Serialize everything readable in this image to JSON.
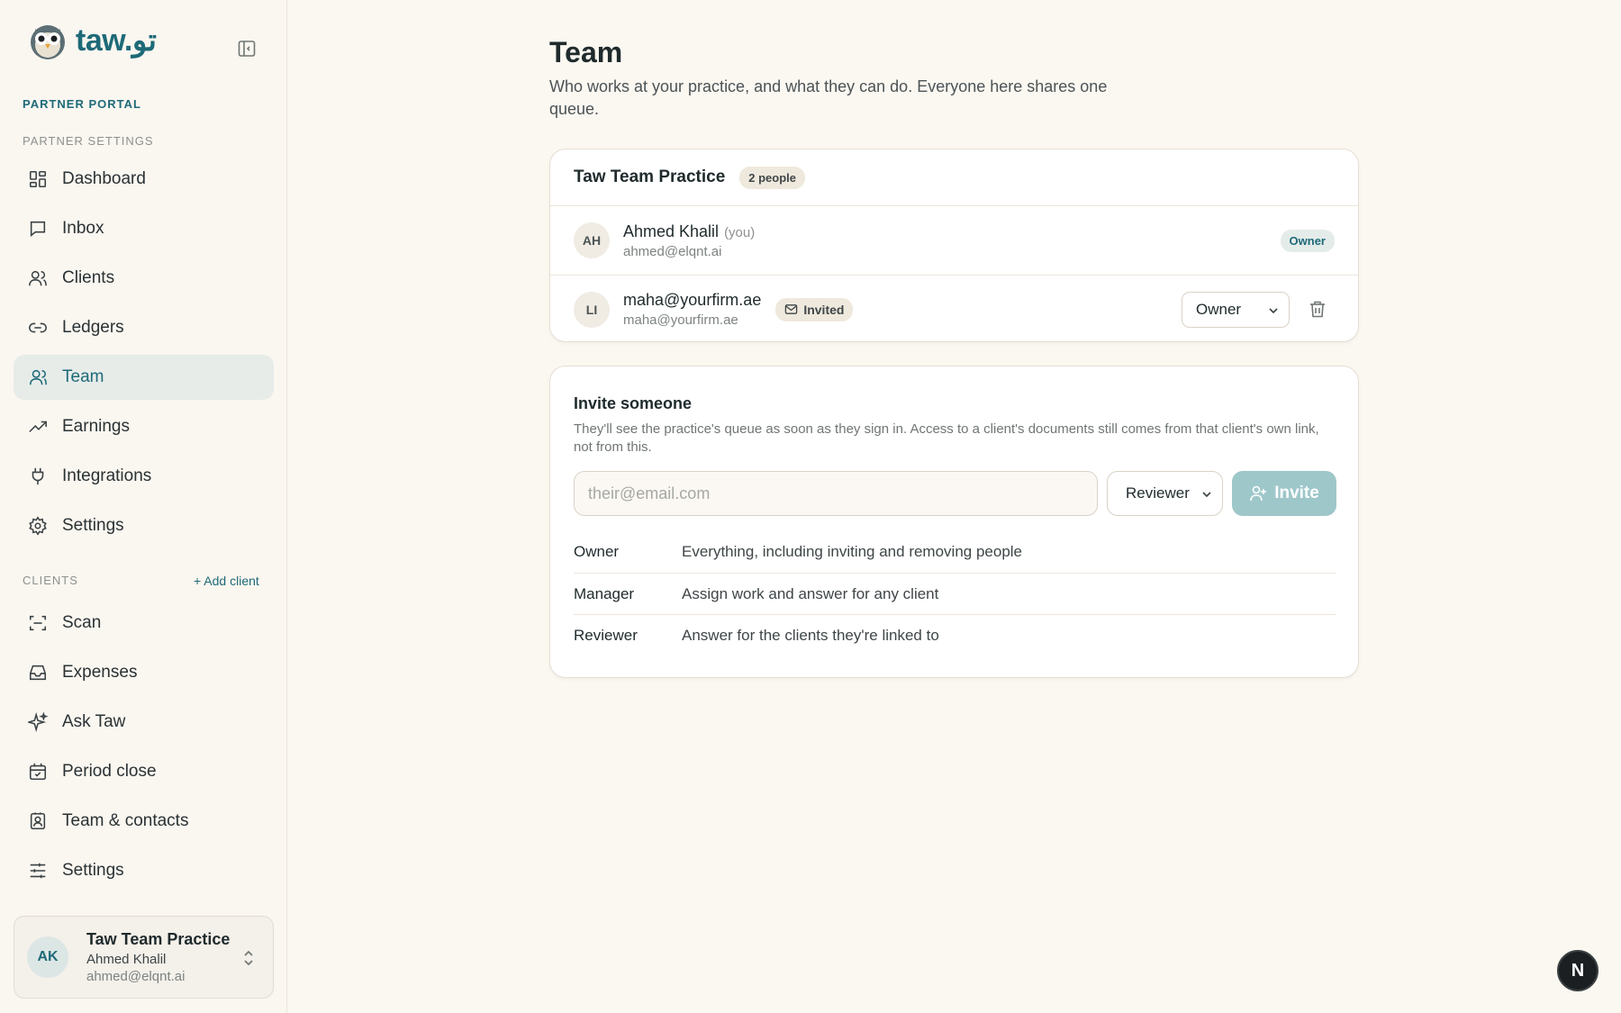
{
  "brand": {
    "wordmark": "taw.تو"
  },
  "sidebar": {
    "portal_label": "PARTNER PORTAL",
    "settings_label": "PARTNER SETTINGS",
    "partner_items": [
      {
        "label": "Dashboard",
        "icon": "dashboard-icon"
      },
      {
        "label": "Inbox",
        "icon": "message-icon"
      },
      {
        "label": "Clients",
        "icon": "users-icon"
      },
      {
        "label": "Ledgers",
        "icon": "link-icon"
      },
      {
        "label": "Team",
        "icon": "user-icon",
        "active": true
      },
      {
        "label": "Earnings",
        "icon": "trending-up-icon"
      },
      {
        "label": "Integrations",
        "icon": "plug-icon"
      },
      {
        "label": "Settings",
        "icon": "gear-icon"
      }
    ],
    "clients_label": "CLIENTS",
    "add_client": "+ Add client",
    "client_items": [
      {
        "label": "Scan",
        "icon": "scan-icon"
      },
      {
        "label": "Expenses",
        "icon": "inbox-tray-icon"
      },
      {
        "label": "Ask Taw",
        "icon": "sparkle-icon"
      },
      {
        "label": "Period close",
        "icon": "calendar-check-icon"
      },
      {
        "label": "Team & contacts",
        "icon": "contact-icon"
      },
      {
        "label": "Settings",
        "icon": "sliders-icon"
      }
    ],
    "account": {
      "initials": "AK",
      "practice": "Taw Team Practice",
      "name": "Ahmed Khalil",
      "email": "ahmed@elqnt.ai"
    }
  },
  "main": {
    "title": "Team",
    "subtitle": "Who works at your practice, and what they can do. Everyone here shares one queue.",
    "team": {
      "practice_name": "Taw Team Practice",
      "count_label": "2 people",
      "members": [
        {
          "initials": "AH",
          "name": "Ahmed Khalil",
          "you_label": "(you)",
          "email": "ahmed@elqnt.ai",
          "role_badge": "Owner"
        },
        {
          "initials": "LI",
          "name": "maha@yourfirm.ae",
          "email": "maha@yourfirm.ae",
          "status_badge": "Invited",
          "role_select": "Owner"
        }
      ]
    },
    "invite": {
      "title": "Invite someone",
      "description": "They'll see the practice's queue as soon as they sign in. Access to a client's documents still comes from that client's own link, not from this.",
      "email_placeholder": "their@email.com",
      "email_value": "",
      "role_selected": "Reviewer",
      "button_label": "Invite",
      "roles": [
        {
          "name": "Owner",
          "desc": "Everything, including inviting and removing people"
        },
        {
          "name": "Manager",
          "desc": "Assign work and answer for any client"
        },
        {
          "name": "Reviewer",
          "desc": "Answer for the clients they're linked to"
        }
      ]
    }
  },
  "fab_label": "N",
  "colors": {
    "accent": "#1e6a78",
    "background": "#fbf7f1",
    "invite_button": "#9ec7ca"
  }
}
